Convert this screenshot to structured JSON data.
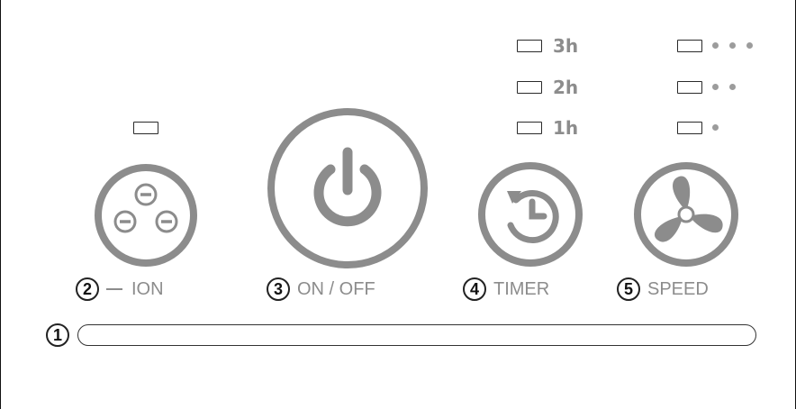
{
  "ion": {
    "number": "2",
    "label": "ION"
  },
  "power": {
    "number": "3",
    "label": "ON / OFF"
  },
  "timer": {
    "number": "4",
    "label": "TIMER",
    "levels": [
      "3h",
      "2h",
      "1h"
    ]
  },
  "speed": {
    "number": "5",
    "label": "SPEED",
    "levels": [
      3,
      2,
      1
    ]
  },
  "sensor": {
    "number": "1"
  },
  "colors": {
    "button_ring": "#8c8c8c",
    "icon": "#8c8c8c",
    "led_outline": "#2a2a2a",
    "text": "#8c8c8c"
  }
}
